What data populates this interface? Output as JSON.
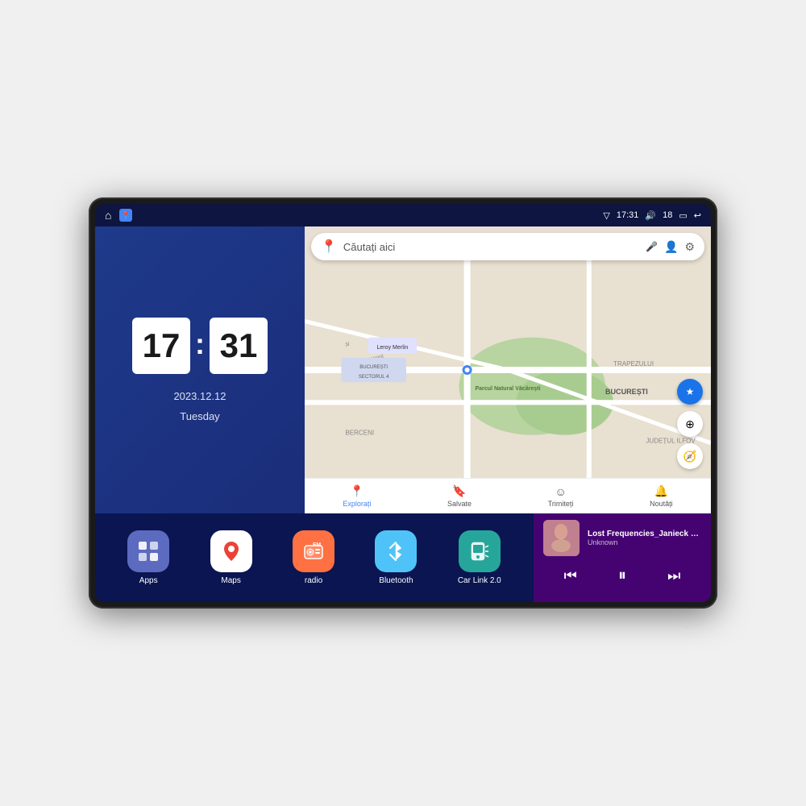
{
  "device": {
    "status_bar": {
      "signal_icon": "▽",
      "time": "17:31",
      "volume_icon": "🔊",
      "battery_level": "18",
      "battery_icon": "▭",
      "back_icon": "↩"
    },
    "clock": {
      "hours": "17",
      "minutes": "31",
      "date": "2023.12.12",
      "day": "Tuesday"
    },
    "map": {
      "search_placeholder": "Căutați aici",
      "bottom_items": [
        {
          "label": "Explorați",
          "icon": "📍",
          "active": true
        },
        {
          "label": "Salvate",
          "icon": "🔖",
          "active": false
        },
        {
          "label": "Trimiteți",
          "icon": "☺",
          "active": false
        },
        {
          "label": "Noutăți",
          "icon": "🔔",
          "active": false
        }
      ]
    },
    "apps": [
      {
        "id": "apps",
        "label": "Apps",
        "icon_type": "apps-icon",
        "icon_char": "⊞"
      },
      {
        "id": "maps",
        "label": "Maps",
        "icon_type": "maps-icon",
        "icon_char": "📍"
      },
      {
        "id": "radio",
        "label": "radio",
        "icon_type": "radio-icon",
        "icon_char": "📻"
      },
      {
        "id": "bluetooth",
        "label": "Bluetooth",
        "icon_type": "bluetooth-icon",
        "icon_char": "⚡"
      },
      {
        "id": "carlink",
        "label": "Car Link 2.0",
        "icon_type": "carlink-icon",
        "icon_char": "📱"
      }
    ],
    "music": {
      "title": "Lost Frequencies_Janieck Devy-...",
      "artist": "Unknown",
      "prev_icon": "⏮",
      "play_icon": "⏸",
      "next_icon": "⏭"
    }
  }
}
